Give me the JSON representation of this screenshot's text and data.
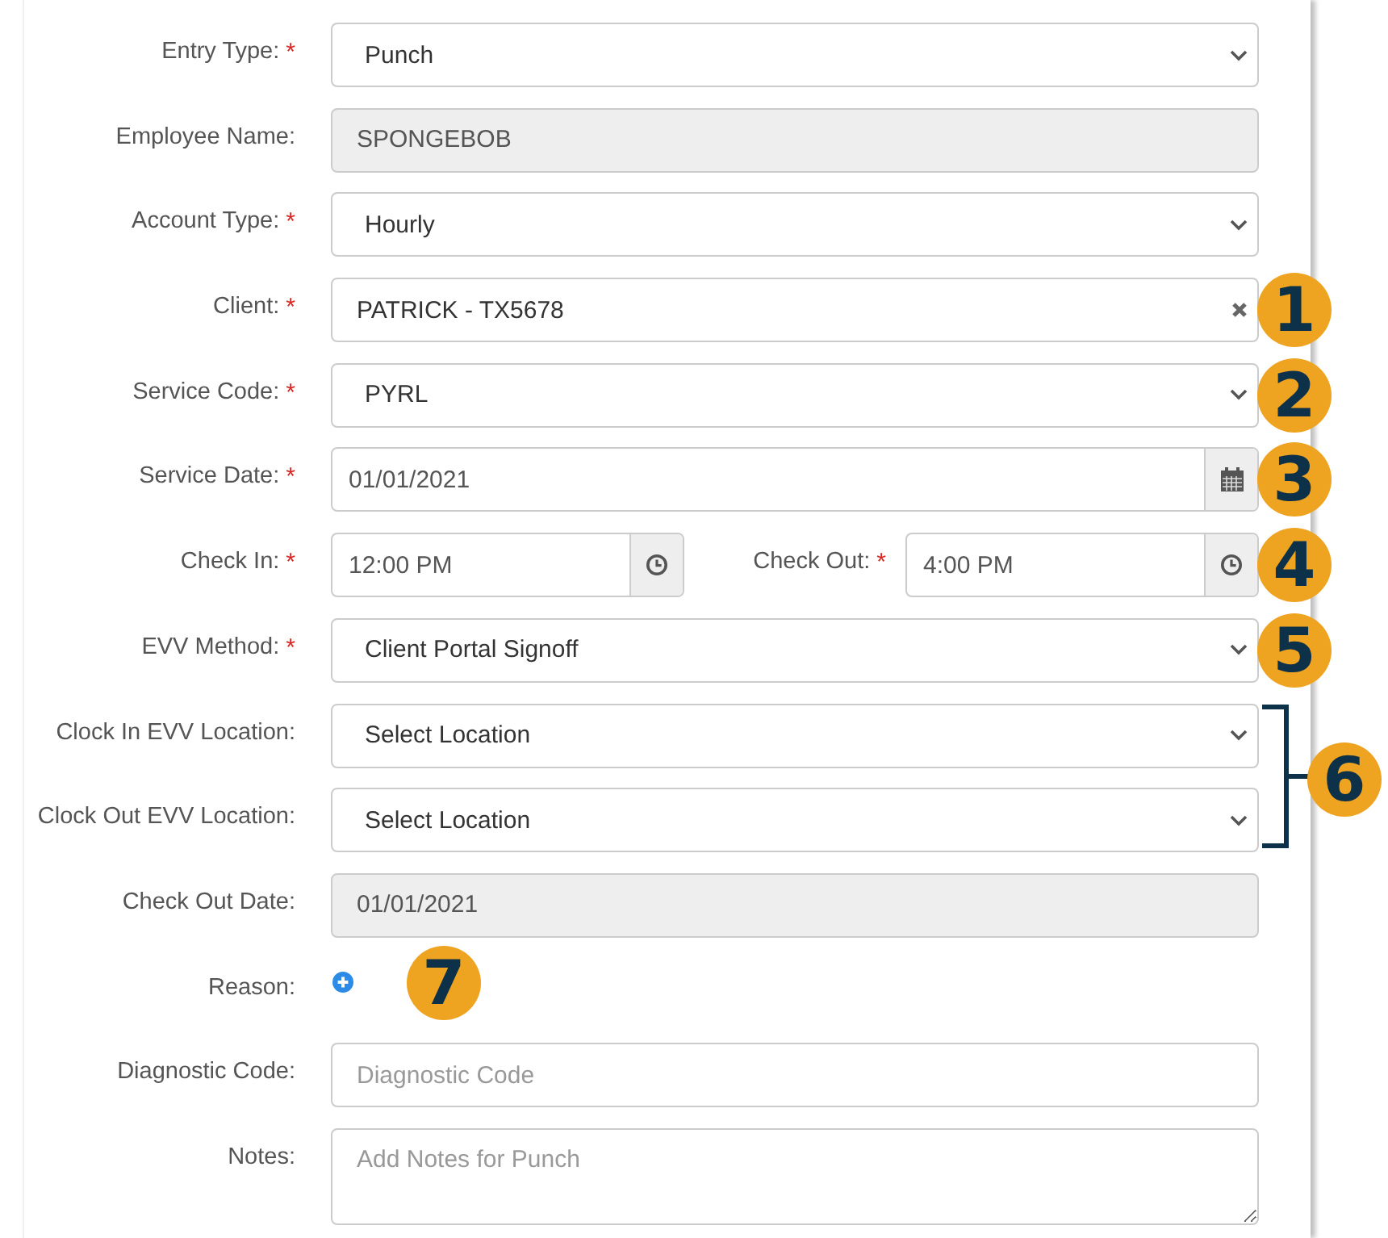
{
  "fields": [
    {
      "kind": "select",
      "label": "Entry Type:",
      "required_mark": "*",
      "value": "Punch"
    },
    {
      "kind": "text",
      "label": "Employee Name:",
      "disabled": true,
      "value": "SPONGEBOB"
    },
    {
      "kind": "select",
      "label": "Account Type:",
      "required_mark": "*",
      "value": "Hourly"
    },
    {
      "kind": "clearable",
      "label": "Client:",
      "required_mark": "*",
      "value": "PATRICK - TX5678",
      "callout": "1"
    },
    {
      "kind": "select",
      "label": "Service Code:",
      "required_mark": "*",
      "value": "PYRL",
      "callout": "2"
    },
    {
      "kind": "date",
      "label": "Service Date:",
      "required_mark": "*",
      "value": "01/01/2021",
      "callout": "3"
    },
    {
      "kind": "time_pair",
      "label": "Check In:",
      "required_mark": "*",
      "value": "12:00 PM",
      "second_label": "Check Out:",
      "second_required_mark": "*",
      "second_value": "4:00 PM",
      "callout": "4"
    },
    {
      "kind": "select",
      "label": "EVV Method:",
      "required_mark": "*",
      "value": "Client Portal Signoff",
      "callout": "5"
    },
    {
      "kind": "group",
      "callout": "6",
      "fields": [
        {
          "kind": "select",
          "label": "Clock In EVV Location:",
          "value": "Select Location"
        },
        {
          "kind": "select",
          "label": "Clock Out EVV Location:",
          "value": "Select Location"
        }
      ]
    },
    {
      "kind": "text",
      "label": "Check Out Date:",
      "disabled": true,
      "value": "01/01/2021"
    },
    {
      "kind": "add",
      "label": "Reason:",
      "callout": "7"
    },
    {
      "kind": "text",
      "label": "Diagnostic Code:",
      "disabled": false,
      "placeholder": "Diagnostic Code"
    },
    {
      "kind": "textarea",
      "label": "Notes:",
      "placeholder": "Add Notes for Punch"
    }
  ]
}
